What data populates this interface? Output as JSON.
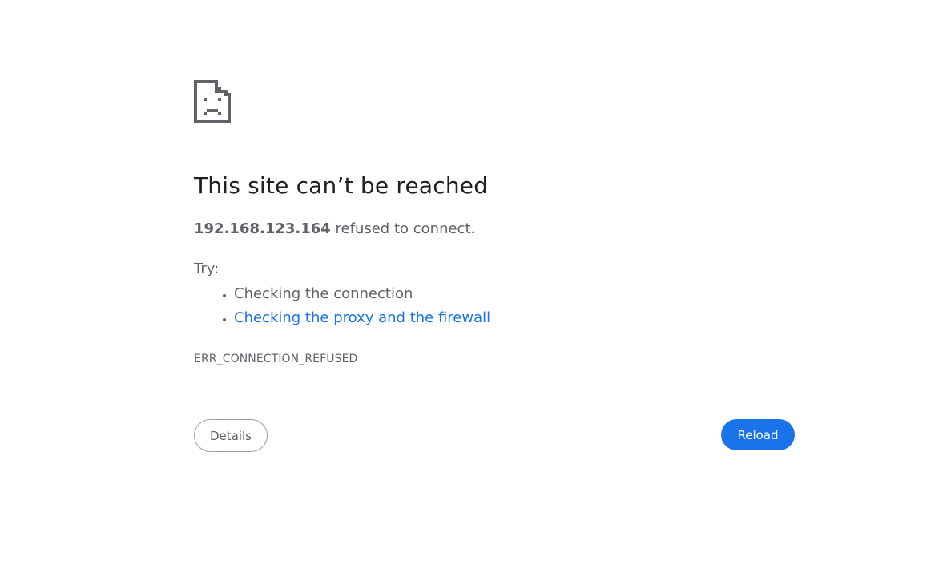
{
  "error_page": {
    "icon": "sad-document-icon",
    "title": "This site can’t be reached",
    "host": "192.168.123.164",
    "summary_suffix": " refused to connect.",
    "try_label": "Try:",
    "suggestions": [
      {
        "label": "Checking the connection",
        "is_link": false
      },
      {
        "label": "Checking the proxy and the firewall",
        "is_link": true
      }
    ],
    "error_code": "ERR_CONNECTION_REFUSED",
    "details_label": "Details",
    "reload_label": "Reload"
  },
  "colors": {
    "title": "#202124",
    "body_text": "#5f6368",
    "link": "#1a73e8",
    "primary_button": "#1a73e8",
    "icon": "#5f6368"
  }
}
